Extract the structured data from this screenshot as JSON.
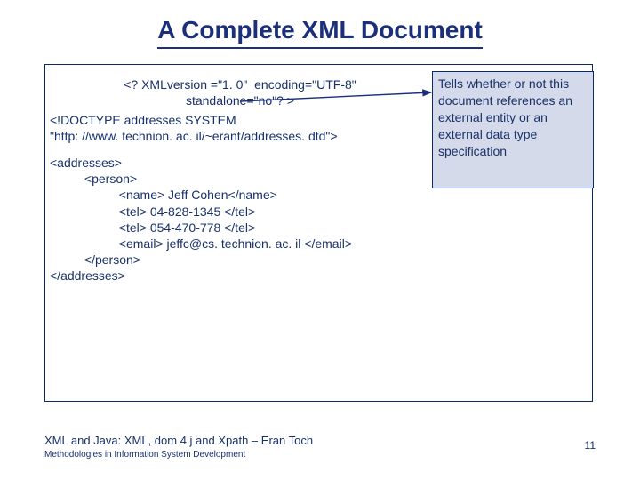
{
  "title": "A Complete XML Document",
  "xml": {
    "decl_line1": "<? XMLversion =\"1. 0\"  encoding=\"UTF-8\"",
    "decl_line2": "standalone=\"no\"? >",
    "doctype_line1": "<!DOCTYPE addresses SYSTEM",
    "doctype_line2": "\"http: //www. technion. ac. il/~erant/addresses. dtd\">",
    "addresses_open": "<addresses>",
    "person_open": "<person>",
    "name_line": "<name> Jeff Cohen</name>",
    "tel1_line": "<tel> 04-828-1345 </tel>",
    "tel2_line": "<tel> 054-470-778 </tel>",
    "email_line": "<email> jeffc@cs. technion. ac. il </email>",
    "person_close": "</person>",
    "addresses_close": "</addresses>"
  },
  "callout": "Tells whether or not this document references an external entity or an external data type specification",
  "footer": {
    "main": "XML and Java: XML, dom 4 j and Xpath – Eran Toch",
    "sub": "Methodologies in Information System Development",
    "page": "11"
  }
}
